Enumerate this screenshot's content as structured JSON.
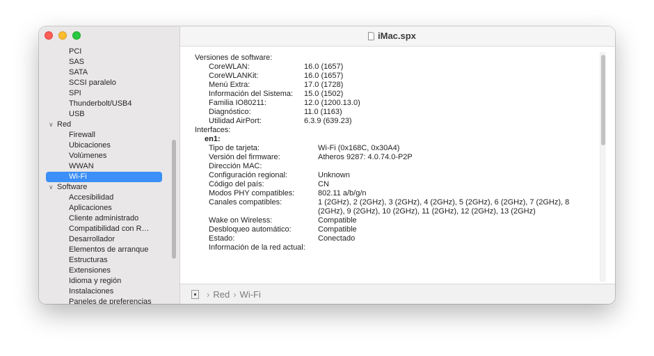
{
  "window": {
    "title": "iMac.spx"
  },
  "sidebar": {
    "items": [
      {
        "label": "PCI",
        "kind": "child"
      },
      {
        "label": "SAS",
        "kind": "child"
      },
      {
        "label": "SATA",
        "kind": "child"
      },
      {
        "label": "SCSI paralelo",
        "kind": "child"
      },
      {
        "label": "SPI",
        "kind": "child"
      },
      {
        "label": "Thunderbolt/USB4",
        "kind": "child"
      },
      {
        "label": "USB",
        "kind": "child"
      },
      {
        "label": "Red",
        "kind": "group"
      },
      {
        "label": "Firewall",
        "kind": "child"
      },
      {
        "label": "Ubicaciones",
        "kind": "child"
      },
      {
        "label": "Volúmenes",
        "kind": "child"
      },
      {
        "label": "WWAN",
        "kind": "child"
      },
      {
        "label": "Wi-Fi",
        "kind": "child",
        "selected": true
      },
      {
        "label": "Software",
        "kind": "group"
      },
      {
        "label": "Accesibilidad",
        "kind": "child"
      },
      {
        "label": "Aplicaciones",
        "kind": "child"
      },
      {
        "label": "Cliente administrado",
        "kind": "child"
      },
      {
        "label": "Compatibilidad con R…",
        "kind": "child"
      },
      {
        "label": "Desarrollador",
        "kind": "child"
      },
      {
        "label": "Elementos de arranque",
        "kind": "child"
      },
      {
        "label": "Estructuras",
        "kind": "child"
      },
      {
        "label": "Extensiones",
        "kind": "child"
      },
      {
        "label": "Idioma y región",
        "kind": "child"
      },
      {
        "label": "Instalaciones",
        "kind": "child"
      },
      {
        "label": "Paneles de preferencias",
        "kind": "child"
      }
    ]
  },
  "content": {
    "software_heading": "Versiones de software:",
    "software": [
      {
        "label": "CoreWLAN:",
        "value": "16.0 (1657)"
      },
      {
        "label": "CoreWLANKit:",
        "value": "16.0 (1657)"
      },
      {
        "label": "Menú Extra:",
        "value": "17.0 (1728)"
      },
      {
        "label": "Información del Sistema:",
        "value": "15.0 (1502)"
      },
      {
        "label": "Familia IO80211:",
        "value": "12.0 (1200.13.0)"
      },
      {
        "label": "Diagnóstico:",
        "value": "11.0 (1163)"
      },
      {
        "label": "Utilidad AirPort:",
        "value": "6.3.9 (639.23)"
      }
    ],
    "interfaces_heading": "Interfaces:",
    "interface_name": "en1:",
    "interface": [
      {
        "label": "Tipo de tarjeta:",
        "value": "Wi-Fi  (0x168C, 0x30A4)"
      },
      {
        "label": "Versión del firmware:",
        "value": "Atheros 9287: 4.0.74.0-P2P"
      },
      {
        "label": "Dirección MAC:",
        "value": ""
      },
      {
        "label": "Configuración regional:",
        "value": "Unknown"
      },
      {
        "label": "Código del país:",
        "value": "CN"
      },
      {
        "label": "Modos PHY compatibles:",
        "value": "802.11 a/b/g/n"
      },
      {
        "label": "Canales compatibles:",
        "value": "1 (2GHz), 2 (2GHz), 3 (2GHz), 4 (2GHz), 5 (2GHz), 6 (2GHz), 7 (2GHz), 8",
        "value2": "(2GHz), 9 (2GHz), 10 (2GHz), 11 (2GHz), 12 (2GHz), 13 (2GHz)"
      },
      {
        "label": "Wake on Wireless:",
        "value": "Compatible"
      },
      {
        "label": "Desbloqueo automático:",
        "value": "Compatible"
      },
      {
        "label": "Estado:",
        "value": "Conectado"
      },
      {
        "label": "Información de la red actual:",
        "value": ""
      }
    ]
  },
  "pathbar": {
    "crumbs": [
      "Red",
      "Wi-Fi"
    ],
    "separator": "›"
  }
}
